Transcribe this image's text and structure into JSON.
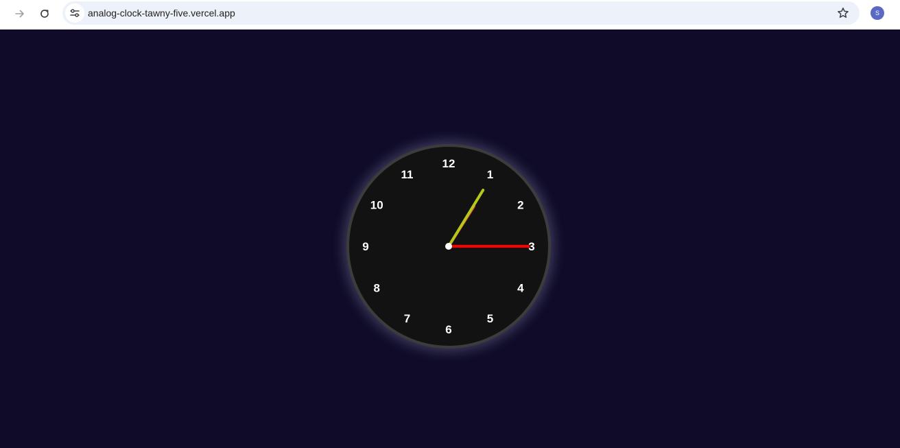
{
  "browser": {
    "url": "analog-clock-tawny-five.vercel.app",
    "profile_initial": "S",
    "icons": {
      "forward": "forward-arrow-icon",
      "reload": "reload-icon",
      "site_info": "site-settings-icon",
      "bookmark": "star-icon"
    }
  },
  "clock": {
    "numbers": [
      "12",
      "1",
      "2",
      "3",
      "4",
      "5",
      "6",
      "7",
      "8",
      "9",
      "10",
      "11"
    ],
    "time": {
      "hours": 1,
      "minutes": 5,
      "seconds": 15
    },
    "colors": {
      "background": "#0f0b29",
      "face": "#121212",
      "rim": "#3c3c3c",
      "numbers": "#ffffff",
      "hour_hand": "#d23b3b",
      "minute_hand": "#b5c918",
      "second_hand": "#ff0000",
      "center_dot": "#ffffff"
    }
  }
}
